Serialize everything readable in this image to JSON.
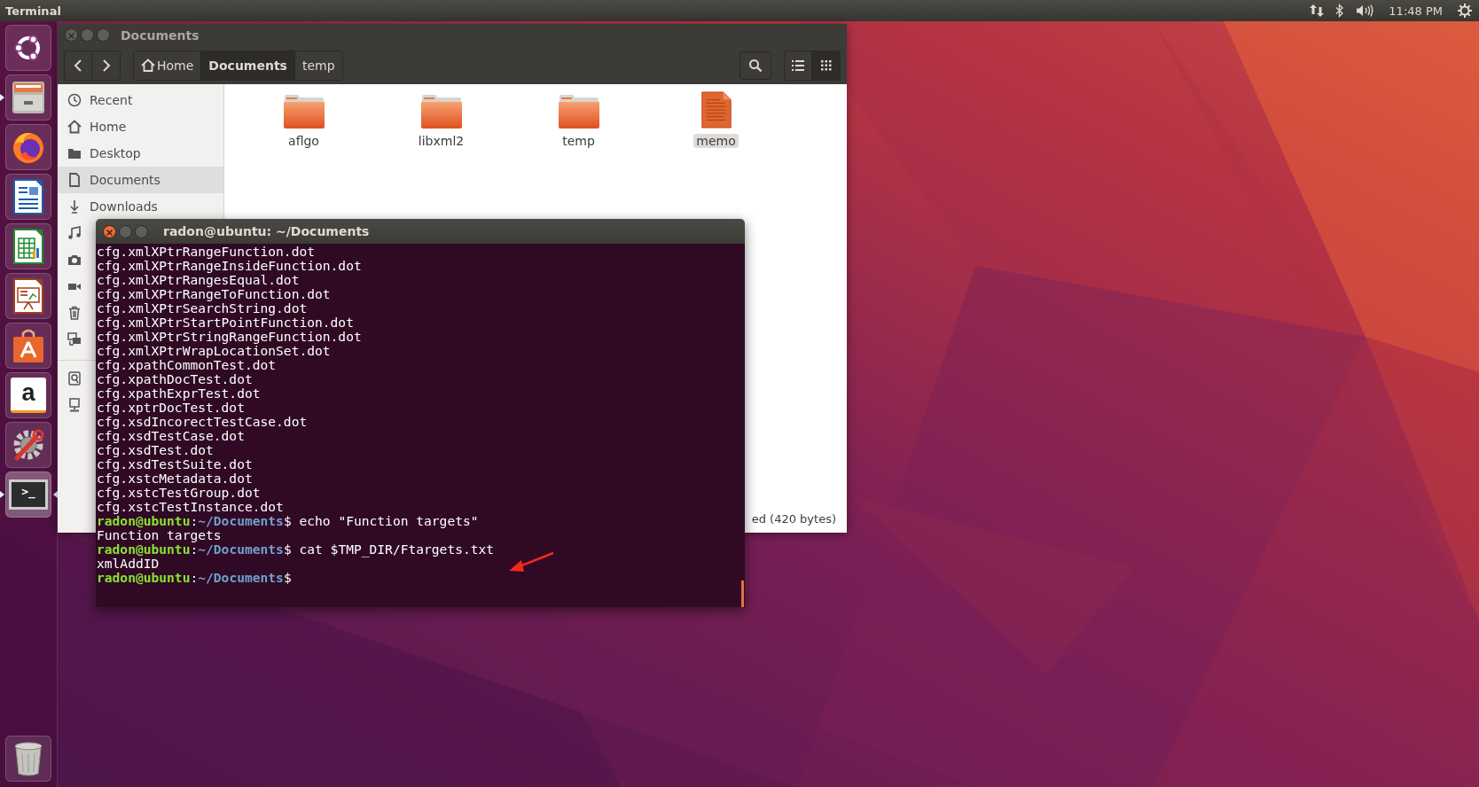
{
  "top_bar": {
    "app_title": "Terminal",
    "clock": "11:48 PM"
  },
  "launcher": {
    "items": [
      {
        "kind": "ubuntu",
        "running": false,
        "focused": false
      },
      {
        "kind": "files",
        "running": true,
        "focused": false
      },
      {
        "kind": "firefox",
        "running": false,
        "focused": false
      },
      {
        "kind": "writer",
        "running": false,
        "focused": false
      },
      {
        "kind": "calc",
        "running": false,
        "focused": false
      },
      {
        "kind": "impress",
        "running": false,
        "focused": false
      },
      {
        "kind": "software",
        "running": false,
        "focused": false
      },
      {
        "kind": "amazon",
        "glyph": "a",
        "running": false,
        "focused": false
      },
      {
        "kind": "settings",
        "running": false,
        "focused": false
      },
      {
        "kind": "terminal",
        "glyph": ">_",
        "running": true,
        "focused": true
      }
    ],
    "trash": {
      "kind": "trash"
    }
  },
  "file_manager": {
    "window": {
      "title": "Documents",
      "focused": false
    },
    "path": [
      {
        "label": "Home",
        "kind": "home",
        "selected": false
      },
      {
        "label": "Documents",
        "kind": "folder",
        "selected": true
      },
      {
        "label": "temp",
        "kind": "folder",
        "selected": false
      }
    ],
    "views": [
      {
        "kind": "list",
        "selected": false
      },
      {
        "kind": "grid",
        "selected": true
      }
    ],
    "sidebar": {
      "items": [
        {
          "label": "Recent",
          "kind": "recent",
          "selected": false
        },
        {
          "label": "Home",
          "kind": "home",
          "selected": false
        },
        {
          "label": "Desktop",
          "kind": "desktop",
          "selected": false
        },
        {
          "label": "Documents",
          "kind": "documents",
          "selected": true
        },
        {
          "label": "Downloads",
          "kind": "downloads",
          "selected": false
        },
        {
          "kind": "music",
          "selected": false
        },
        {
          "kind": "pictures",
          "selected": false
        },
        {
          "kind": "videos",
          "selected": false
        },
        {
          "kind": "trash",
          "selected": false
        },
        {
          "kind": "network",
          "selected": false
        },
        {
          "kind": "separator"
        },
        {
          "kind": "drive",
          "selected": false
        },
        {
          "kind": "server",
          "selected": false
        }
      ]
    },
    "files": [
      {
        "name": "aflgo",
        "kind": "folder",
        "selected": false
      },
      {
        "name": "libxml2",
        "kind": "folder",
        "selected": false
      },
      {
        "name": "temp",
        "kind": "folder",
        "selected": false
      },
      {
        "name": "memo",
        "kind": "document",
        "selected": true
      }
    ],
    "status": "ed (420 bytes)"
  },
  "terminal": {
    "window": {
      "title": "radon@ubuntu: ~/Documents",
      "focused": true
    },
    "lines": [
      {
        "kind": "output",
        "text": "cfg.xmlXPtrRangeFunction.dot"
      },
      {
        "kind": "output",
        "text": "cfg.xmlXPtrRangeInsideFunction.dot"
      },
      {
        "kind": "output",
        "text": "cfg.xmlXPtrRangesEqual.dot"
      },
      {
        "kind": "output",
        "text": "cfg.xmlXPtrRangeToFunction.dot"
      },
      {
        "kind": "output",
        "text": "cfg.xmlXPtrSearchString.dot"
      },
      {
        "kind": "output",
        "text": "cfg.xmlXPtrStartPointFunction.dot"
      },
      {
        "kind": "output",
        "text": "cfg.xmlXPtrStringRangeFunction.dot"
      },
      {
        "kind": "output",
        "text": "cfg.xmlXPtrWrapLocationSet.dot"
      },
      {
        "kind": "output",
        "text": "cfg.xpathCommonTest.dot"
      },
      {
        "kind": "output",
        "text": "cfg.xpathDocTest.dot"
      },
      {
        "kind": "output",
        "text": "cfg.xpathExprTest.dot"
      },
      {
        "kind": "output",
        "text": "cfg.xptrDocTest.dot"
      },
      {
        "kind": "output",
        "text": "cfg.xsdIncorectTestCase.dot"
      },
      {
        "kind": "output",
        "text": "cfg.xsdTestCase.dot"
      },
      {
        "kind": "output",
        "text": "cfg.xsdTest.dot"
      },
      {
        "kind": "output",
        "text": "cfg.xsdTestSuite.dot"
      },
      {
        "kind": "output",
        "text": "cfg.xstcMetadata.dot"
      },
      {
        "kind": "output",
        "text": "cfg.xstcTestGroup.dot"
      },
      {
        "kind": "output",
        "text": "cfg.xstcTestInstance.dot"
      },
      {
        "kind": "prompt",
        "user": "radon@ubuntu",
        "separator": ":",
        "path": "~/Documents",
        "symbol": "$",
        "command": "echo \"Function targets\""
      },
      {
        "kind": "output",
        "text": "Function targets"
      },
      {
        "kind": "prompt",
        "user": "radon@ubuntu",
        "separator": ":",
        "path": "~/Documents",
        "symbol": "$",
        "command": "cat $TMP_DIR/Ftargets.txt"
      },
      {
        "kind": "output",
        "text": "xmlAddID"
      },
      {
        "kind": "prompt",
        "user": "radon@ubuntu",
        "separator": ":",
        "path": "~/Documents",
        "symbol": "$"
      }
    ]
  }
}
